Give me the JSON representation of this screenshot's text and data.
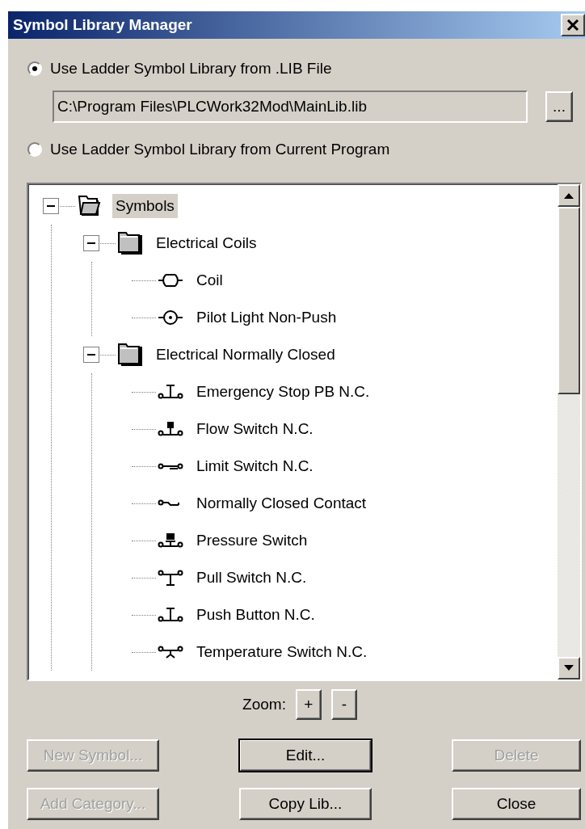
{
  "window": {
    "title": "Symbol Library Manager"
  },
  "source_options": [
    {
      "label": "Use Ladder Symbol Library from .LIB File",
      "selected": true
    },
    {
      "label": "Use Ladder Symbol Library from Current Program",
      "selected": false
    }
  ],
  "lib_path": {
    "value": "C:\\Program Files\\PLCWork32Mod\\MainLib.lib"
  },
  "browse_button": {
    "label": "..."
  },
  "tree": {
    "items": [
      {
        "label": "Symbols",
        "kind": "root",
        "expanded": true,
        "selected": true,
        "children": [
          {
            "label": "Electrical Coils",
            "kind": "category",
            "expanded": true,
            "selected": false,
            "children": [
              {
                "label": "Coil",
                "kind": "coil",
                "selected": false
              },
              {
                "label": "Pilot Light Non-Push",
                "kind": "pilot-light",
                "selected": false
              }
            ]
          },
          {
            "label": "Electrical Normally Closed",
            "kind": "category",
            "expanded": true,
            "selected": false,
            "children": [
              {
                "label": "Emergency Stop PB N.C.",
                "kind": "push-button",
                "selected": false
              },
              {
                "label": "Flow Switch N.C.",
                "kind": "flow-switch",
                "selected": false
              },
              {
                "label": "Limit Switch N.C.",
                "kind": "limit-switch",
                "selected": false
              },
              {
                "label": "Normally Closed Contact",
                "kind": "contact",
                "selected": false
              },
              {
                "label": "Pressure Switch",
                "kind": "pressure-switch",
                "selected": false
              },
              {
                "label": "Pull Switch N.C.",
                "kind": "pull-switch",
                "selected": false
              },
              {
                "label": "Push Button N.C.",
                "kind": "push-button",
                "selected": false
              },
              {
                "label": "Temperature Switch N.C.",
                "kind": "temperature-switch",
                "selected": false
              }
            ]
          }
        ]
      }
    ]
  },
  "zoom": {
    "label": "Zoom:",
    "buttons": [
      "+",
      "-"
    ]
  },
  "buttons": [
    {
      "label": "New Symbol...",
      "disabled": true,
      "default": false
    },
    {
      "label": "Edit...",
      "disabled": false,
      "default": true
    },
    {
      "label": "Delete",
      "disabled": true,
      "default": false
    },
    {
      "label": "Add Category...",
      "disabled": true,
      "default": false
    },
    {
      "label": "Copy Lib...",
      "disabled": false,
      "default": false
    },
    {
      "label": "Close",
      "disabled": false,
      "default": false
    }
  ]
}
